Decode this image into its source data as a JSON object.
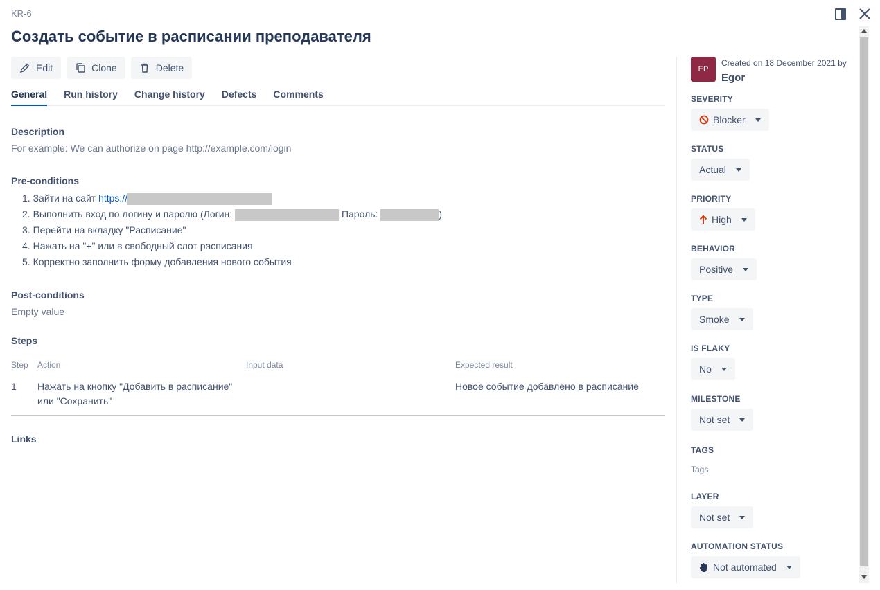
{
  "header": {
    "key": "KR-6",
    "title": "Создать событие в расписании преподавателя"
  },
  "toolbar": {
    "edit_label": "Edit",
    "clone_label": "Clone",
    "delete_label": "Delete"
  },
  "tabs": [
    {
      "label": "General",
      "active": true
    },
    {
      "label": "Run history"
    },
    {
      "label": "Change history"
    },
    {
      "label": "Defects"
    },
    {
      "label": "Comments"
    }
  ],
  "description": {
    "label": "Description",
    "value": "For example: We can authorize on page http://example.com/login"
  },
  "preconditions": {
    "label": "Pre-conditions",
    "items": [
      {
        "num": "1.",
        "text": "Зайти на сайт ",
        "link": "https://"
      },
      {
        "num": "2.",
        "text": "Выполнить вход по логину и паролю (Логин: ",
        "middle": " Пароль: ",
        "end": ")"
      },
      {
        "num": "3.",
        "text": "Перейти на вкладку \"Расписание\""
      },
      {
        "num": "4.",
        "text": "Нажать на \"+\" или в свободный слот расписания"
      },
      {
        "num": "5.",
        "text": "Корректно заполнить форму добавления нового события"
      }
    ]
  },
  "postconditions": {
    "label": "Post-conditions",
    "value": "Empty value"
  },
  "steps": {
    "label": "Steps",
    "columns": [
      "Step",
      "Action",
      "Input data",
      "Expected result"
    ],
    "rows": [
      {
        "step": "1",
        "action_line1": "Нажать на кнопку \"Добавить в расписание\"",
        "action_line2": "или \"Сохранить\"",
        "input": "",
        "expected": "Новое событие добавлено в расписание"
      }
    ]
  },
  "links": {
    "label": "Links"
  },
  "sidebar": {
    "avatar_initials": "EP",
    "avatar_color": "#8f2845",
    "created_text": "Created on 18 December 2021 by",
    "creator": "Egor",
    "fields": {
      "severity": {
        "label": "SEVERITY",
        "value": "Blocker",
        "icon": "blocker-icon"
      },
      "status": {
        "label": "STATUS",
        "value": "Actual"
      },
      "priority": {
        "label": "PRIORITY",
        "value": "High",
        "icon": "arrow-up-icon"
      },
      "behavior": {
        "label": "BEHAVIOR",
        "value": "Positive"
      },
      "type": {
        "label": "TYPE",
        "value": "Smoke"
      },
      "is_flaky": {
        "label": "IS FLAKY",
        "value": "No"
      },
      "milestone": {
        "label": "MILESTONE",
        "value": "Not set"
      },
      "tags": {
        "label": "TAGS",
        "value": "Tags"
      },
      "layer": {
        "label": "LAYER",
        "value": "Not set"
      },
      "automation_status": {
        "label": "AUTOMATION STATUS",
        "value": "Not automated",
        "icon": "hand-icon"
      }
    }
  },
  "colors": {
    "accent": "#0052cc",
    "blocker": "#de350b",
    "priority_high": "#de350b"
  }
}
